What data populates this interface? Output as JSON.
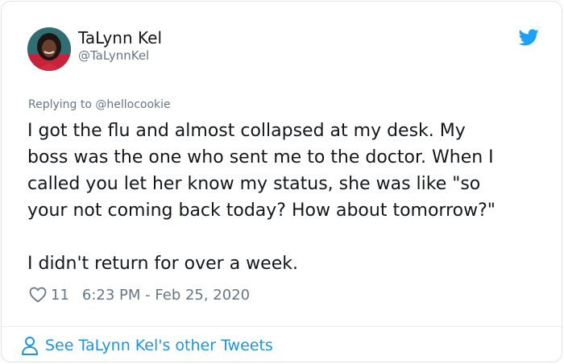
{
  "tweet": {
    "author_name": "TaLynn Kel",
    "author_handle": "@TaLynnKel",
    "replying_prefix": "Replying to",
    "replying_to": "@hellocookie",
    "body_lines": [
      "I got the flu and almost collapsed at my desk. My",
      "boss was the one who sent me to the doctor. When I",
      "called you let her know my status, she was like \"so",
      "your not coming back today? How about tomorrow?\"",
      "I didn't return for over a week."
    ],
    "likes": "11",
    "timestamp": "6:23 PM - Feb 25, 2020"
  },
  "footer": {
    "label": "See TaLynn Kel's other Tweets"
  },
  "icons": {
    "bird": "twitter-bird-icon",
    "heart": "heart-outline-icon",
    "person": "person-outline-icon"
  },
  "colors": {
    "text": "#14171a",
    "secondary": "#657786",
    "accent": "#1b95e0",
    "border": "#dfe3e6"
  }
}
